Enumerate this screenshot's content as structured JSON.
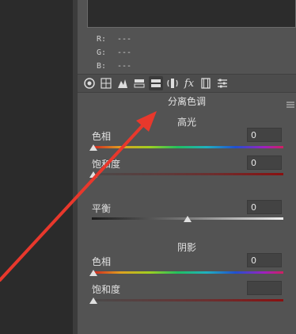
{
  "readout": {
    "r_label": "R:",
    "r_value": "---",
    "g_label": "G:",
    "g_value": "---",
    "b_label": "B:",
    "b_value": "---"
  },
  "toolbar": {
    "icons": [
      "aperture-icon",
      "grid-icon",
      "curve-icon",
      "hsl-icon",
      "split-tone-icon",
      "lens-icon",
      "fx-icon",
      "film-icon",
      "presets-icon"
    ],
    "fx_text": "fx"
  },
  "panel": {
    "title": "分离色调"
  },
  "highlights": {
    "title": "高光",
    "hue_label": "色相",
    "hue_value": "0",
    "sat_label": "饱和度",
    "sat_value": "0"
  },
  "balance": {
    "label": "平衡",
    "value": "0"
  },
  "shadows": {
    "title": "阴影",
    "hue_label": "色相",
    "hue_value": "0",
    "sat_label": "饱和度",
    "sat_value": ""
  },
  "colors": {
    "panel_bg": "#535353",
    "arrow": "#e8382c"
  }
}
